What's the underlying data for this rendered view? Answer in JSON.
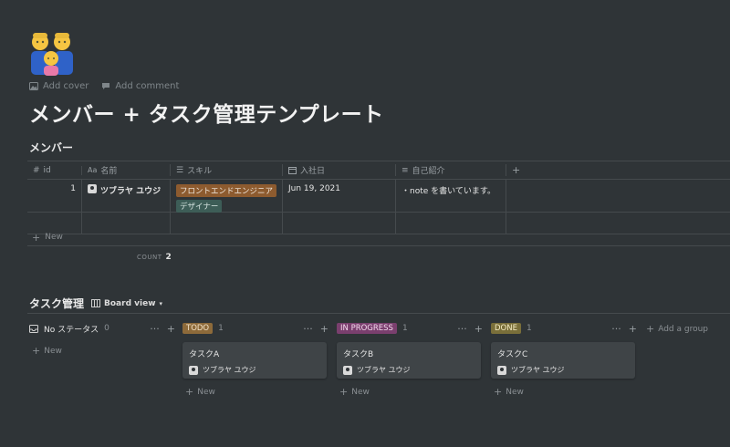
{
  "page": {
    "icon_name": "family-emoji-icon",
    "add_cover": "Add cover",
    "add_comment": "Add comment",
    "title": "メンバー + タスク管理テンプレート"
  },
  "members": {
    "section_title": "メンバー",
    "columns": [
      {
        "label": "id",
        "icon": "number-icon"
      },
      {
        "label": "名前",
        "icon": "text-icon"
      },
      {
        "label": "スキル",
        "icon": "list-icon"
      },
      {
        "label": "入社日",
        "icon": "calendar-icon"
      },
      {
        "label": "自己紹介",
        "icon": "paragraph-icon"
      },
      {
        "label": "+",
        "icon": "plus-icon"
      }
    ],
    "rows": [
      {
        "id": "1",
        "name": "ツブラヤ ユウジ",
        "skills": [
          "フロントエンドエンジニア",
          "デザイナー"
        ],
        "joined": "Jun 19, 2021",
        "intro": "・note を書いています。"
      }
    ],
    "new_label": "New",
    "count_label": "COUNT",
    "count_value": "2"
  },
  "board": {
    "section_title": "タスク管理",
    "view_label": "Board view",
    "add_group": "Add a group",
    "columns": [
      {
        "label": "No ステータス",
        "count": "0",
        "cards": [],
        "new_label": "New"
      },
      {
        "label": "TODO",
        "count": "1",
        "color": "#8d6a3a",
        "cards": [
          {
            "title": "タスクA",
            "person": "ツブラヤ ユウジ"
          }
        ],
        "new_label": "New"
      },
      {
        "label": "IN PROGRESS",
        "count": "1",
        "color": "#7a3f6e",
        "cards": [
          {
            "title": "タスクB",
            "person": "ツブラヤ ユウジ"
          }
        ],
        "new_label": "New"
      },
      {
        "label": "DONE",
        "count": "1",
        "color": "#7a6f3a",
        "cards": [
          {
            "title": "タスクC",
            "person": "ツブラヤ ユウジ"
          }
        ],
        "new_label": "New"
      }
    ]
  }
}
